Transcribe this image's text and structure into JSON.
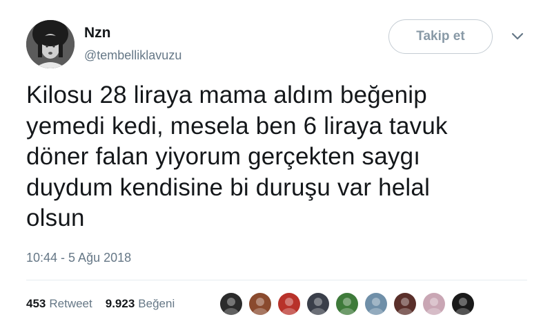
{
  "user": {
    "display_name": "Nzn",
    "handle": "@tembelliklavuzu"
  },
  "follow_button_label": "Takip et",
  "tweet": {
    "lines": [
      "Kilosu 28 liraya mama aldım beğenip",
      "yemedi kedi, mesela ben 6 liraya tavuk",
      "döner falan yiyorum gerçekten saygı",
      "duydum kendisine bi duruşu var helal",
      "olsun"
    ],
    "timestamp": "10:44 - 5 Ağu 2018"
  },
  "stats": {
    "retweets": "453",
    "retweets_label": "Retweet",
    "likes": "9.923",
    "likes_label": "Beğeni"
  },
  "likers": [
    {
      "name": "liker-avatar-1",
      "color": "#2b2b2b"
    },
    {
      "name": "liker-avatar-2",
      "color": "#8a4a2e"
    },
    {
      "name": "liker-avatar-3",
      "color": "#b8322a"
    },
    {
      "name": "liker-avatar-4",
      "color": "#3a3f4a"
    },
    {
      "name": "liker-avatar-5",
      "color": "#3e7a3a"
    },
    {
      "name": "liker-avatar-6",
      "color": "#6f8fa8"
    },
    {
      "name": "liker-avatar-7",
      "color": "#5a2f2a"
    },
    {
      "name": "liker-avatar-8",
      "color": "#c9a6b4"
    },
    {
      "name": "liker-avatar-9",
      "color": "#1a1a1a"
    }
  ],
  "colors": {
    "text": "#14171a",
    "secondary": "#657786",
    "divider": "#e6ecf0",
    "follow_border": "#c4ccd3"
  }
}
